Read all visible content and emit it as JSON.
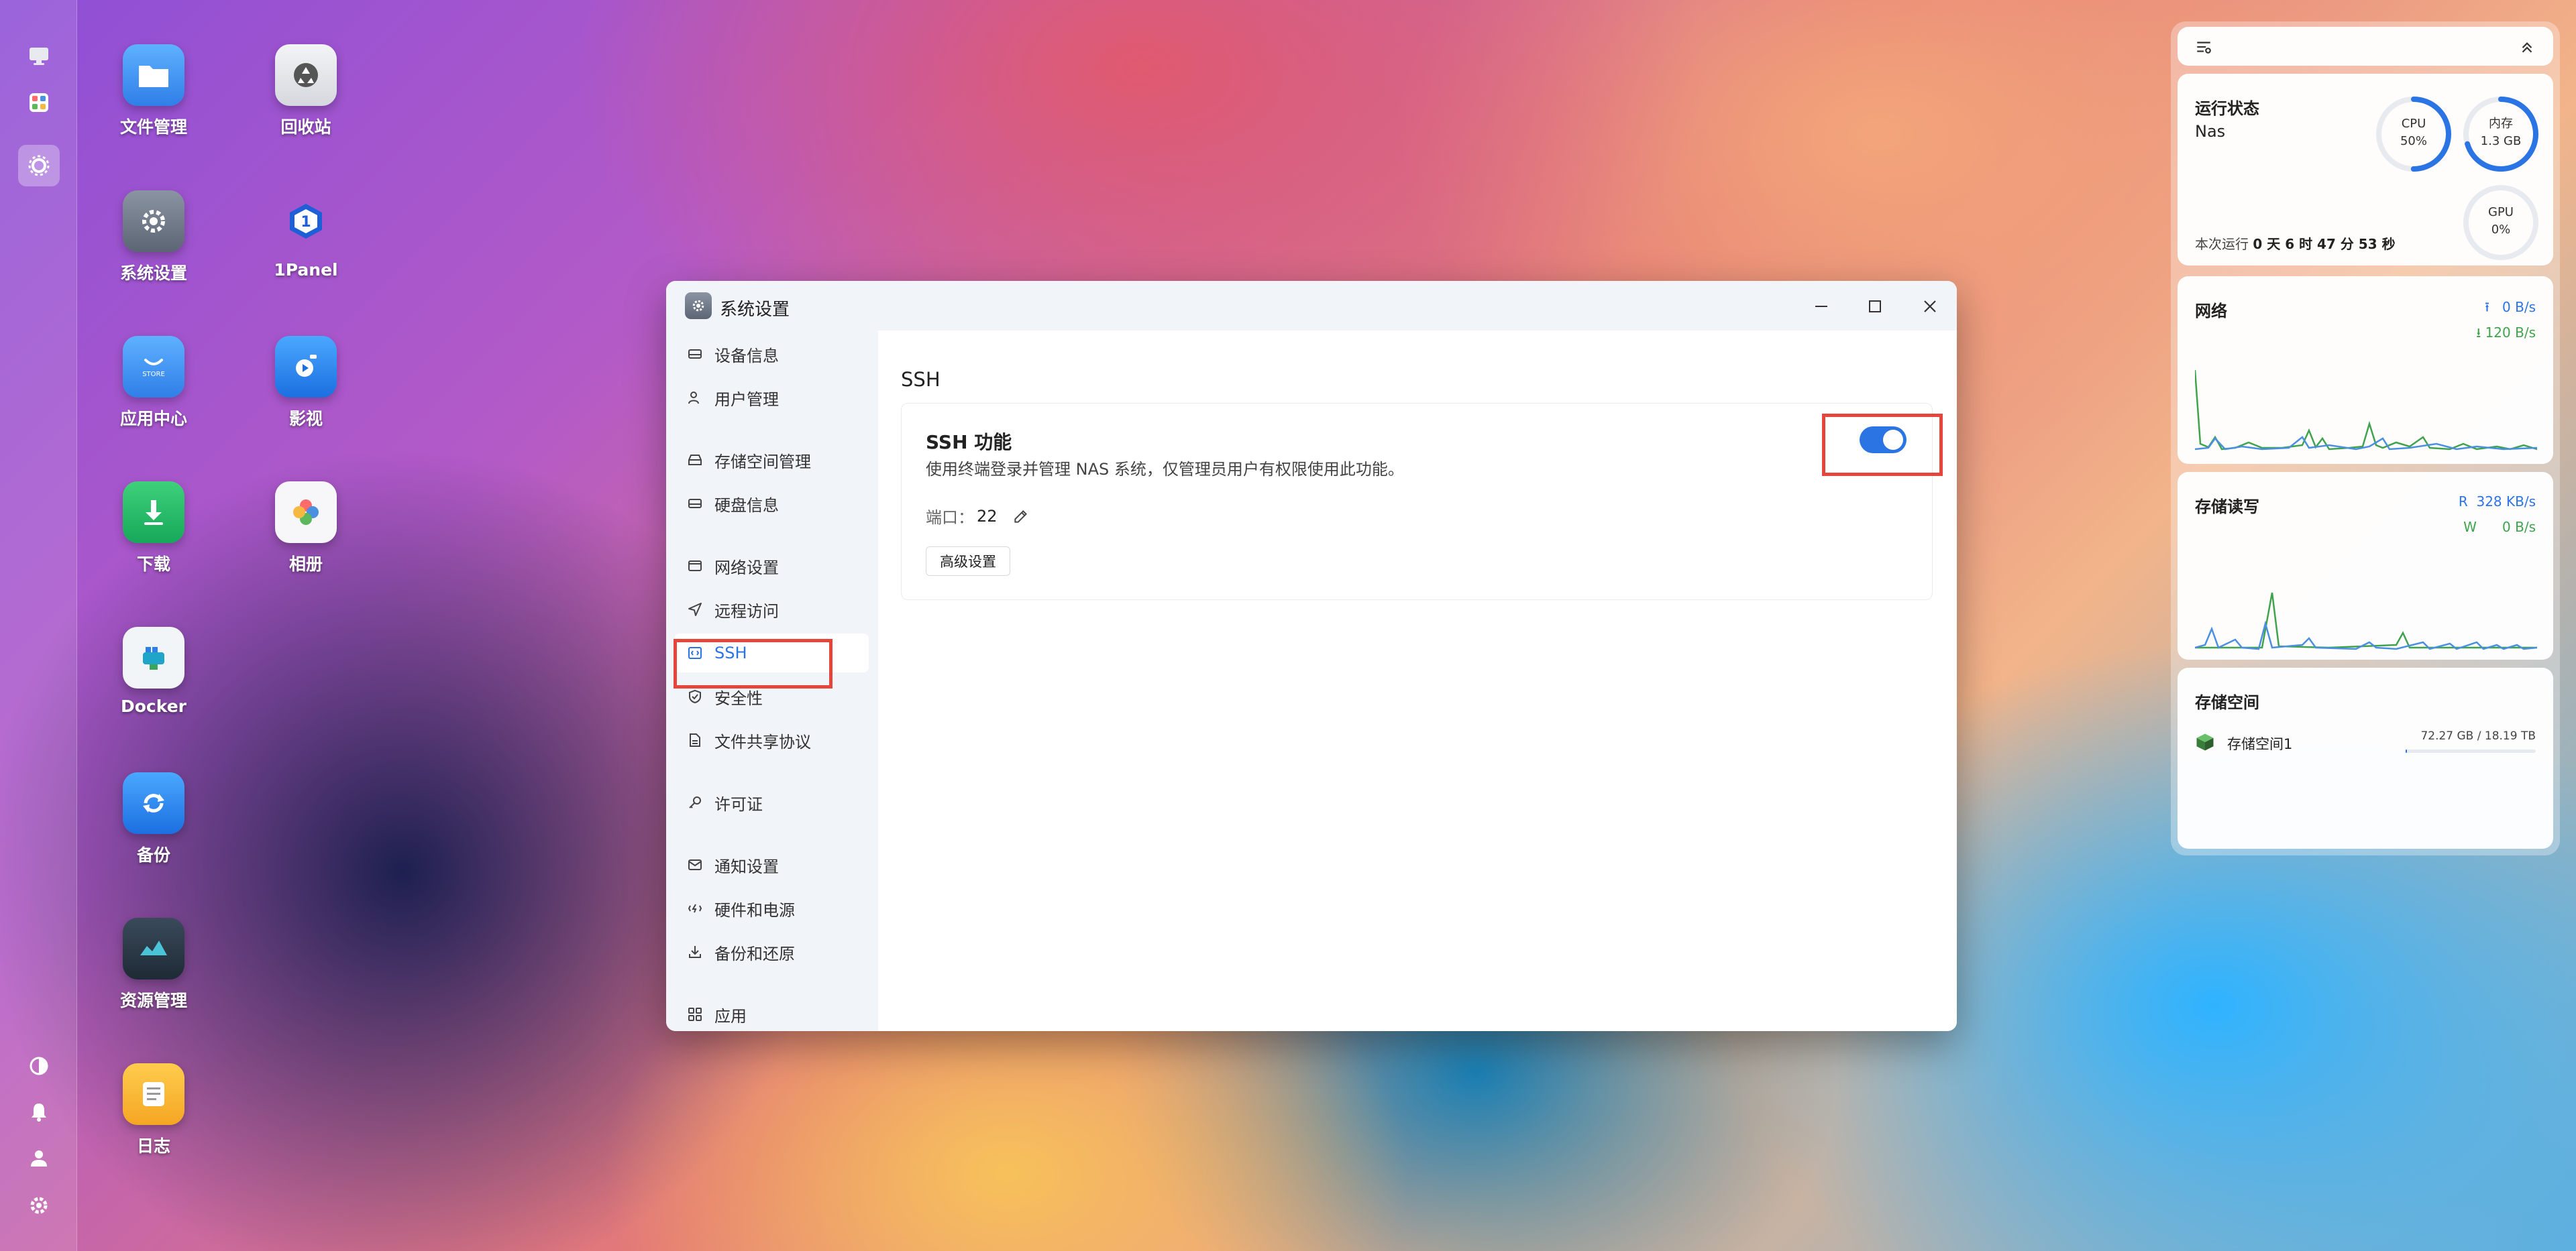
{
  "desktop": {
    "icons": [
      {
        "label": "文件管理",
        "icon": "folder-icon"
      },
      {
        "label": "回收站",
        "icon": "recycle-bin-icon"
      },
      {
        "label": "系统设置",
        "icon": "gear-icon"
      },
      {
        "label": "1Panel",
        "icon": "1panel-icon"
      },
      {
        "label": "应用中心",
        "icon": "store-icon",
        "sub": "STORE"
      },
      {
        "label": "影视",
        "icon": "video-icon"
      },
      {
        "label": "下载",
        "icon": "download-icon"
      },
      {
        "label": "相册",
        "icon": "photos-icon"
      },
      {
        "label": "Docker",
        "icon": "docker-icon"
      },
      {
        "label": "备份",
        "icon": "backup-icon"
      },
      {
        "label": "资源管理",
        "icon": "resource-monitor-icon"
      },
      {
        "label": "日志",
        "icon": "log-icon"
      }
    ]
  },
  "window": {
    "title": "系统设置",
    "sidebar": {
      "items": [
        {
          "label": "设备信息",
          "icon": "hard-drive-icon"
        },
        {
          "label": "用户管理",
          "icon": "user-icon"
        },
        {
          "label": "存储空间管理",
          "icon": "storage-icon"
        },
        {
          "label": "硬盘信息",
          "icon": "disk-icon"
        },
        {
          "label": "网络设置",
          "icon": "network-icon"
        },
        {
          "label": "远程访问",
          "icon": "send-icon"
        },
        {
          "label": "SSH",
          "icon": "code-icon",
          "active": true
        },
        {
          "label": "安全性",
          "icon": "shield-icon"
        },
        {
          "label": "文件共享协议",
          "icon": "file-icon"
        },
        {
          "label": "许可证",
          "icon": "key-icon"
        },
        {
          "label": "通知设置",
          "icon": "mail-icon"
        },
        {
          "label": "硬件和电源",
          "icon": "power-icon"
        },
        {
          "label": "备份和还原",
          "icon": "restore-icon"
        },
        {
          "label": "应用",
          "icon": "apps-icon"
        }
      ]
    },
    "content": {
      "section_title": "SSH",
      "card": {
        "title": "SSH 功能",
        "description": "使用终端登录并管理 NAS 系统，仅管理员用户有权限使用此功能。",
        "port_label": "端口：",
        "port_value": "22",
        "advanced_button": "高级设置",
        "enabled": true
      }
    }
  },
  "widgets": {
    "status": {
      "title": "运行状态",
      "host": "Nas",
      "cpu_label": "CPU",
      "cpu_value": "50%",
      "cpu_percent": 50,
      "mem_label": "内存",
      "mem_value": "1.3 GB",
      "gpu_label": "GPU",
      "gpu_value": "0%",
      "uptime_prefix": "本次运行",
      "uptime_value": "0 天 6 时 47 分 53 秒"
    },
    "network": {
      "title": "网络",
      "upload": "0 B/s",
      "download": "120 B/s"
    },
    "storage_io": {
      "title": "存储读写",
      "read_label": "R",
      "read": "328 KB/s",
      "write_label": "W",
      "write": "0 B/s"
    },
    "storage": {
      "title": "存储空间",
      "pool_name": "存储空间1",
      "usage": "72.27 GB / 18.19 TB"
    }
  },
  "colors": {
    "accent": "#2b74e3",
    "highlight": "#e5453b",
    "chart_blue": "#4a8fe0",
    "chart_green": "#5cb85c"
  }
}
